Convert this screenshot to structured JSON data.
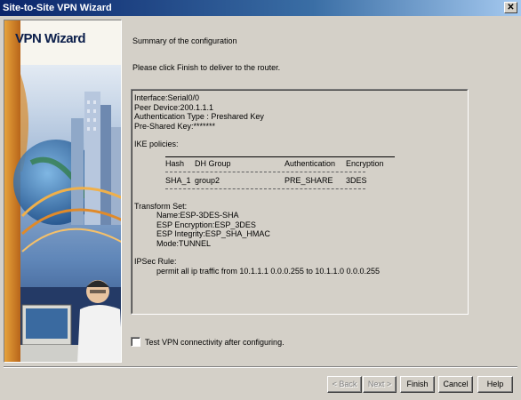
{
  "window": {
    "title": "Site-to-Site VPN Wizard",
    "close_glyph": "✕"
  },
  "sidebar": {
    "title": "VPN Wizard"
  },
  "main": {
    "heading": "Summary of the configuration",
    "instruction": "Please click Finish to deliver to the router."
  },
  "summary": {
    "interface": "Interface:Serial0/0",
    "peer_device": "Peer Device:200.1.1.1",
    "auth_type": "Authentication Type : Preshared Key",
    "pre_shared_key": "Pre-Shared Key:*******",
    "ike_label": "IKE policies:",
    "ike_headers": [
      "Hash",
      "DH Group",
      "Authentication",
      "Encryption"
    ],
    "ike_rows": [
      [
        "SHA_1",
        "group2",
        "PRE_SHARE",
        "3DES"
      ]
    ],
    "transform_label": "Transform Set:",
    "transform_lines": [
      "Name:ESP-3DES-SHA",
      "ESP Encryption:ESP_3DES",
      "ESP Integrity:ESP_SHA_HMAC",
      "Mode:TUNNEL"
    ],
    "ipsec_label": "IPSec Rule:",
    "ipsec_rule": "permit all ip traffic from 10.1.1.1 0.0.0.255 to 10.1.1.0 0.0.0.255"
  },
  "test_checkbox": {
    "label": "Test VPN connectivity after configuring.",
    "checked": false
  },
  "buttons": {
    "back": "< Back",
    "next": "Next >",
    "finish": "Finish",
    "cancel": "Cancel",
    "help": "Help"
  }
}
